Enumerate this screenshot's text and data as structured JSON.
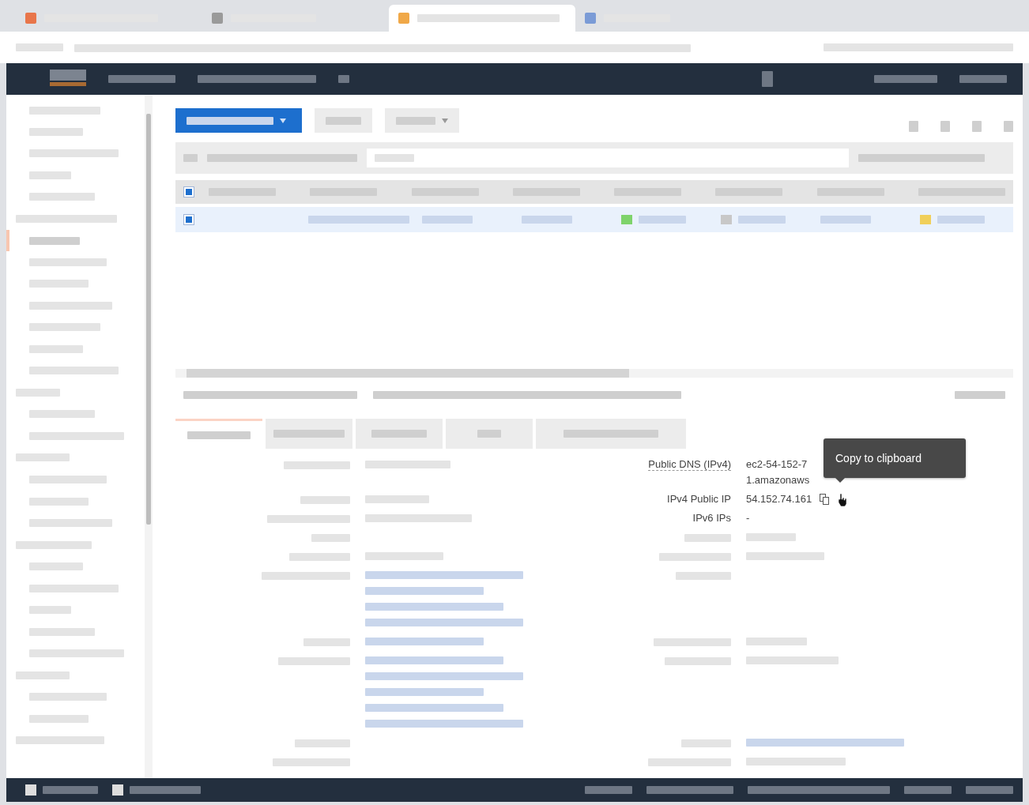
{
  "browser": {
    "tabs": [
      {
        "selected": false,
        "color": "#e8754a"
      },
      {
        "selected": false,
        "color": "#9a9a9a"
      },
      {
        "selected": true,
        "color": "#f0a848"
      },
      {
        "selected": false,
        "color": "#7b9bd6"
      }
    ]
  },
  "navbar": {
    "left": [
      {
        "kind": "menu"
      },
      {
        "kind": "menu"
      },
      {
        "kind": "icon"
      }
    ],
    "right": [
      {
        "kind": "icon"
      },
      {
        "kind": "menu"
      },
      {
        "kind": "menu"
      }
    ]
  },
  "sidebar": {
    "items": [
      {
        "kind": "item",
        "selected": false
      },
      {
        "kind": "item",
        "selected": false
      },
      {
        "kind": "item",
        "selected": false
      },
      {
        "kind": "item",
        "selected": false
      },
      {
        "kind": "item",
        "selected": false
      },
      {
        "kind": "heading"
      },
      {
        "kind": "item",
        "selected": true
      },
      {
        "kind": "item",
        "selected": false
      },
      {
        "kind": "item",
        "selected": false
      },
      {
        "kind": "item",
        "selected": false
      },
      {
        "kind": "item",
        "selected": false
      },
      {
        "kind": "item",
        "selected": false
      },
      {
        "kind": "item",
        "selected": false
      },
      {
        "kind": "heading"
      },
      {
        "kind": "item",
        "selected": false
      },
      {
        "kind": "item",
        "selected": false
      },
      {
        "kind": "heading"
      },
      {
        "kind": "item",
        "selected": false
      },
      {
        "kind": "item",
        "selected": false
      },
      {
        "kind": "item",
        "selected": false
      },
      {
        "kind": "heading"
      },
      {
        "kind": "item",
        "selected": false
      },
      {
        "kind": "item",
        "selected": false
      },
      {
        "kind": "item",
        "selected": false
      },
      {
        "kind": "item",
        "selected": false
      },
      {
        "kind": "item",
        "selected": false
      },
      {
        "kind": "heading"
      },
      {
        "kind": "item",
        "selected": false
      },
      {
        "kind": "item",
        "selected": false
      },
      {
        "kind": "heading"
      }
    ]
  },
  "toolbar": {
    "buttons": [
      {
        "kind": "primary",
        "caret": true
      },
      {
        "kind": "default",
        "caret": false
      },
      {
        "kind": "default",
        "caret": true
      }
    ]
  },
  "table": {
    "select_all": {
      "checked": true
    },
    "columns": [
      {
        "kind": "blurred"
      },
      {
        "kind": "blurred"
      },
      {
        "kind": "blurred"
      },
      {
        "kind": "blurred"
      },
      {
        "kind": "blurred"
      },
      {
        "kind": "blurred"
      },
      {
        "kind": "blurred"
      },
      {
        "kind": "blurred"
      }
    ],
    "rows": [
      {
        "selected": true,
        "checked": true,
        "cells": [
          {
            "kind": "blank"
          },
          {
            "kind": "blurred"
          },
          {
            "kind": "blurred"
          },
          {
            "kind": "blurred"
          },
          {
            "kind": "status",
            "color": "#7ed36b"
          },
          {
            "kind": "status",
            "color": "#c8c8c8"
          },
          {
            "kind": "blurred"
          },
          {
            "kind": "status",
            "color": "#f0cf5a"
          }
        ]
      }
    ]
  },
  "details": {
    "tabs": [
      {
        "selected": true
      },
      {
        "selected": false
      },
      {
        "selected": false
      },
      {
        "selected": false
      },
      {
        "selected": false
      }
    ],
    "rows": [
      {
        "left": {
          "label": {
            "kind": "blurred"
          },
          "values": [
            {
              "kind": "blurred"
            }
          ]
        },
        "right": {
          "label": {
            "kind": "text",
            "text": "Public DNS (IPv4)",
            "underlined": true
          },
          "values": [
            {
              "kind": "text",
              "text": "ec2-54-152-7"
            },
            {
              "kind": "text",
              "text": "1.amazonaws"
            }
          ]
        }
      },
      {
        "left": {
          "label": {
            "kind": "blurred"
          },
          "values": [
            {
              "kind": "blurred"
            }
          ]
        },
        "right": {
          "label": {
            "kind": "text",
            "text": "IPv4 Public IP",
            "underlined": false
          },
          "values": [
            {
              "kind": "text",
              "text": "54.152.74.161",
              "copy_icon": true
            }
          ]
        }
      },
      {
        "left": {
          "label": {
            "kind": "blurred"
          },
          "values": [
            {
              "kind": "blurred"
            }
          ]
        },
        "right": {
          "label": {
            "kind": "text",
            "text": "IPv6 IPs",
            "underlined": false
          },
          "values": [
            {
              "kind": "text",
              "text": "-"
            }
          ]
        }
      },
      {
        "left": {
          "label": {
            "kind": "blurred"
          }
        },
        "right": {
          "label": {
            "kind": "blurred"
          },
          "values": [
            {
              "kind": "blurred"
            }
          ]
        }
      },
      {
        "left": {
          "label": {
            "kind": "blurred"
          },
          "values": [
            {
              "kind": "blurred"
            }
          ]
        },
        "right": {
          "label": {
            "kind": "blurred"
          },
          "values": [
            {
              "kind": "blurred"
            }
          ]
        }
      },
      {
        "left": {
          "label": {
            "kind": "blurred"
          },
          "values": [
            {
              "kind": "blurred-link"
            },
            {
              "kind": "blurred-link"
            },
            {
              "kind": "blurred-link"
            },
            {
              "kind": "blurred-link"
            }
          ]
        },
        "right": {
          "label": {
            "kind": "blurred"
          }
        }
      },
      {
        "left": {
          "label": {
            "kind": "blurred"
          },
          "values": [
            {
              "kind": "blurred-link"
            }
          ]
        },
        "right": {
          "label": {
            "kind": "blurred"
          },
          "values": [
            {
              "kind": "blurred"
            }
          ]
        }
      },
      {
        "left": {
          "label": {
            "kind": "blurred"
          },
          "values": [
            {
              "kind": "blurred-link"
            },
            {
              "kind": "blurred-link"
            },
            {
              "kind": "blurred-link"
            },
            {
              "kind": "blurred-link"
            },
            {
              "kind": "blurred-link"
            }
          ]
        },
        "right": {
          "label": {
            "kind": "blurred"
          },
          "values": [
            {
              "kind": "blurred"
            }
          ]
        }
      },
      {
        "left": {
          "label": {
            "kind": "blurred"
          }
        },
        "right": {
          "label": {
            "kind": "blurred"
          },
          "values": [
            {
              "kind": "blurred-link"
            }
          ]
        }
      },
      {
        "left": {
          "label": {
            "kind": "blurred"
          }
        },
        "right": {
          "label": {
            "kind": "blurred"
          },
          "values": [
            {
              "kind": "blurred"
            }
          ]
        }
      }
    ],
    "tooltip": {
      "text": "Copy to clipboard"
    }
  },
  "footer": {
    "left": [
      {
        "kind": "blurred"
      },
      {
        "kind": "blurred"
      }
    ],
    "right": [
      {
        "kind": "blurred"
      },
      {
        "kind": "blurred"
      },
      {
        "kind": "blurred"
      },
      {
        "kind": "blurred"
      },
      {
        "kind": "blurred"
      }
    ]
  }
}
